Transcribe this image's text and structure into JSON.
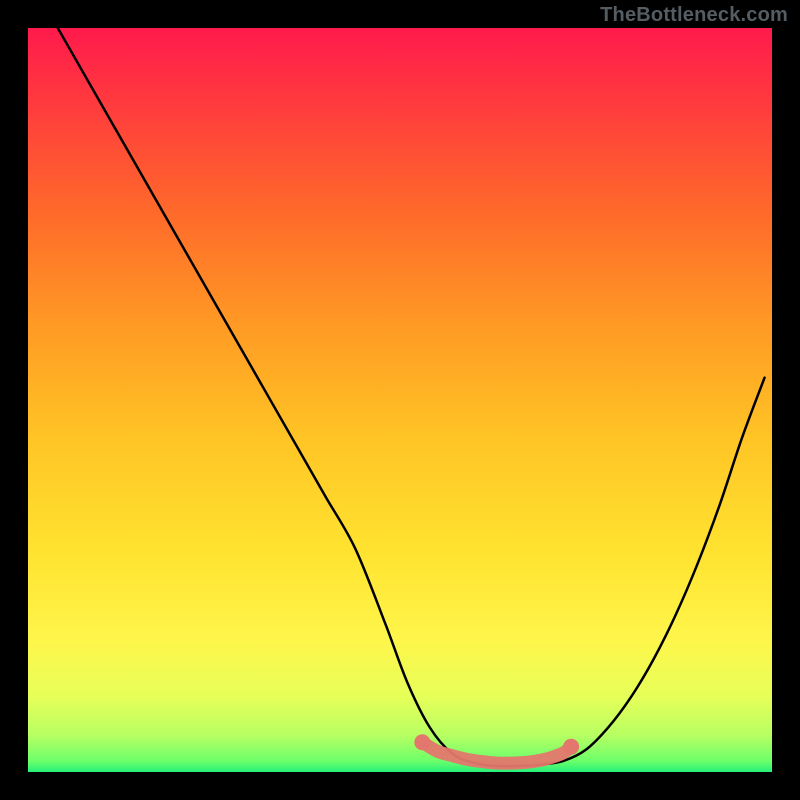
{
  "watermark": "TheBottleneck.com",
  "colors": {
    "frame": "#000000",
    "watermark": "#555d63",
    "curve": "#000000",
    "highlight": "#e4776d",
    "gradient_stops": [
      {
        "offset": 0.0,
        "color": "#ff1a4c"
      },
      {
        "offset": 0.1,
        "color": "#ff3a3e"
      },
      {
        "offset": 0.25,
        "color": "#ff6a2a"
      },
      {
        "offset": 0.4,
        "color": "#ff9a24"
      },
      {
        "offset": 0.55,
        "color": "#ffc425"
      },
      {
        "offset": 0.7,
        "color": "#ffe22f"
      },
      {
        "offset": 0.82,
        "color": "#fff54a"
      },
      {
        "offset": 0.9,
        "color": "#e6ff59"
      },
      {
        "offset": 0.95,
        "color": "#b8ff62"
      },
      {
        "offset": 0.985,
        "color": "#6dff6a"
      },
      {
        "offset": 1.0,
        "color": "#25f07a"
      }
    ]
  },
  "chart_data": {
    "type": "line",
    "title": "",
    "xlabel": "",
    "ylabel": "",
    "xlim": [
      0,
      100
    ],
    "ylim": [
      0,
      100
    ],
    "grid": false,
    "legend": false,
    "series": [
      {
        "name": "curve",
        "x": [
          4,
          8,
          12,
          16,
          20,
          24,
          28,
          32,
          36,
          40,
          44,
          48,
          51,
          54,
          57,
          60,
          63,
          66,
          69,
          72,
          75,
          78,
          81,
          84,
          87,
          90,
          93,
          96,
          99
        ],
        "y": [
          100,
          93,
          86,
          79,
          72,
          65,
          58,
          51,
          44,
          37,
          30,
          20,
          12,
          6,
          2.5,
          1.2,
          0.8,
          0.8,
          1.0,
          1.5,
          3.0,
          6.0,
          10,
          15,
          21,
          28,
          36,
          45,
          53
        ]
      }
    ],
    "highlight": {
      "color": "#e4776d",
      "points_x": [
        53,
        55,
        57,
        59,
        61,
        63,
        65,
        67,
        69,
        70.5,
        72,
        73
      ],
      "points_y": [
        4.0,
        2.8,
        2.2,
        1.7,
        1.4,
        1.2,
        1.2,
        1.3,
        1.6,
        2.0,
        2.6,
        3.4
      ]
    }
  }
}
